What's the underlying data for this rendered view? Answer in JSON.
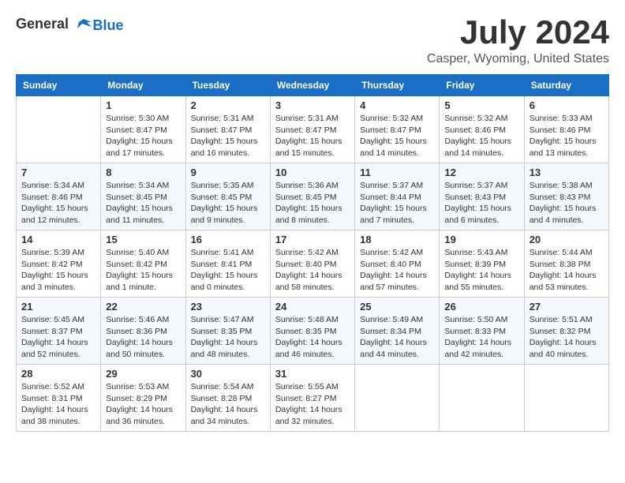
{
  "header": {
    "logo_general": "General",
    "logo_blue": "Blue",
    "month_title": "July 2024",
    "location": "Casper, Wyoming, United States"
  },
  "calendar": {
    "days_of_week": [
      "Sunday",
      "Monday",
      "Tuesday",
      "Wednesday",
      "Thursday",
      "Friday",
      "Saturday"
    ],
    "weeks": [
      [
        {
          "day": "",
          "info": ""
        },
        {
          "day": "1",
          "info": "Sunrise: 5:30 AM\nSunset: 8:47 PM\nDaylight: 15 hours\nand 17 minutes."
        },
        {
          "day": "2",
          "info": "Sunrise: 5:31 AM\nSunset: 8:47 PM\nDaylight: 15 hours\nand 16 minutes."
        },
        {
          "day": "3",
          "info": "Sunrise: 5:31 AM\nSunset: 8:47 PM\nDaylight: 15 hours\nand 15 minutes."
        },
        {
          "day": "4",
          "info": "Sunrise: 5:32 AM\nSunset: 8:47 PM\nDaylight: 15 hours\nand 14 minutes."
        },
        {
          "day": "5",
          "info": "Sunrise: 5:32 AM\nSunset: 8:46 PM\nDaylight: 15 hours\nand 14 minutes."
        },
        {
          "day": "6",
          "info": "Sunrise: 5:33 AM\nSunset: 8:46 PM\nDaylight: 15 hours\nand 13 minutes."
        }
      ],
      [
        {
          "day": "7",
          "info": "Sunrise: 5:34 AM\nSunset: 8:46 PM\nDaylight: 15 hours\nand 12 minutes."
        },
        {
          "day": "8",
          "info": "Sunrise: 5:34 AM\nSunset: 8:45 PM\nDaylight: 15 hours\nand 11 minutes."
        },
        {
          "day": "9",
          "info": "Sunrise: 5:35 AM\nSunset: 8:45 PM\nDaylight: 15 hours\nand 9 minutes."
        },
        {
          "day": "10",
          "info": "Sunrise: 5:36 AM\nSunset: 8:45 PM\nDaylight: 15 hours\nand 8 minutes."
        },
        {
          "day": "11",
          "info": "Sunrise: 5:37 AM\nSunset: 8:44 PM\nDaylight: 15 hours\nand 7 minutes."
        },
        {
          "day": "12",
          "info": "Sunrise: 5:37 AM\nSunset: 8:43 PM\nDaylight: 15 hours\nand 6 minutes."
        },
        {
          "day": "13",
          "info": "Sunrise: 5:38 AM\nSunset: 8:43 PM\nDaylight: 15 hours\nand 4 minutes."
        }
      ],
      [
        {
          "day": "14",
          "info": "Sunrise: 5:39 AM\nSunset: 8:42 PM\nDaylight: 15 hours\nand 3 minutes."
        },
        {
          "day": "15",
          "info": "Sunrise: 5:40 AM\nSunset: 8:42 PM\nDaylight: 15 hours\nand 1 minute."
        },
        {
          "day": "16",
          "info": "Sunrise: 5:41 AM\nSunset: 8:41 PM\nDaylight: 15 hours\nand 0 minutes."
        },
        {
          "day": "17",
          "info": "Sunrise: 5:42 AM\nSunset: 8:40 PM\nDaylight: 14 hours\nand 58 minutes."
        },
        {
          "day": "18",
          "info": "Sunrise: 5:42 AM\nSunset: 8:40 PM\nDaylight: 14 hours\nand 57 minutes."
        },
        {
          "day": "19",
          "info": "Sunrise: 5:43 AM\nSunset: 8:39 PM\nDaylight: 14 hours\nand 55 minutes."
        },
        {
          "day": "20",
          "info": "Sunrise: 5:44 AM\nSunset: 8:38 PM\nDaylight: 14 hours\nand 53 minutes."
        }
      ],
      [
        {
          "day": "21",
          "info": "Sunrise: 5:45 AM\nSunset: 8:37 PM\nDaylight: 14 hours\nand 52 minutes."
        },
        {
          "day": "22",
          "info": "Sunrise: 5:46 AM\nSunset: 8:36 PM\nDaylight: 14 hours\nand 50 minutes."
        },
        {
          "day": "23",
          "info": "Sunrise: 5:47 AM\nSunset: 8:35 PM\nDaylight: 14 hours\nand 48 minutes."
        },
        {
          "day": "24",
          "info": "Sunrise: 5:48 AM\nSunset: 8:35 PM\nDaylight: 14 hours\nand 46 minutes."
        },
        {
          "day": "25",
          "info": "Sunrise: 5:49 AM\nSunset: 8:34 PM\nDaylight: 14 hours\nand 44 minutes."
        },
        {
          "day": "26",
          "info": "Sunrise: 5:50 AM\nSunset: 8:33 PM\nDaylight: 14 hours\nand 42 minutes."
        },
        {
          "day": "27",
          "info": "Sunrise: 5:51 AM\nSunset: 8:32 PM\nDaylight: 14 hours\nand 40 minutes."
        }
      ],
      [
        {
          "day": "28",
          "info": "Sunrise: 5:52 AM\nSunset: 8:31 PM\nDaylight: 14 hours\nand 38 minutes."
        },
        {
          "day": "29",
          "info": "Sunrise: 5:53 AM\nSunset: 8:29 PM\nDaylight: 14 hours\nand 36 minutes."
        },
        {
          "day": "30",
          "info": "Sunrise: 5:54 AM\nSunset: 8:28 PM\nDaylight: 14 hours\nand 34 minutes."
        },
        {
          "day": "31",
          "info": "Sunrise: 5:55 AM\nSunset: 8:27 PM\nDaylight: 14 hours\nand 32 minutes."
        },
        {
          "day": "",
          "info": ""
        },
        {
          "day": "",
          "info": ""
        },
        {
          "day": "",
          "info": ""
        }
      ]
    ]
  }
}
